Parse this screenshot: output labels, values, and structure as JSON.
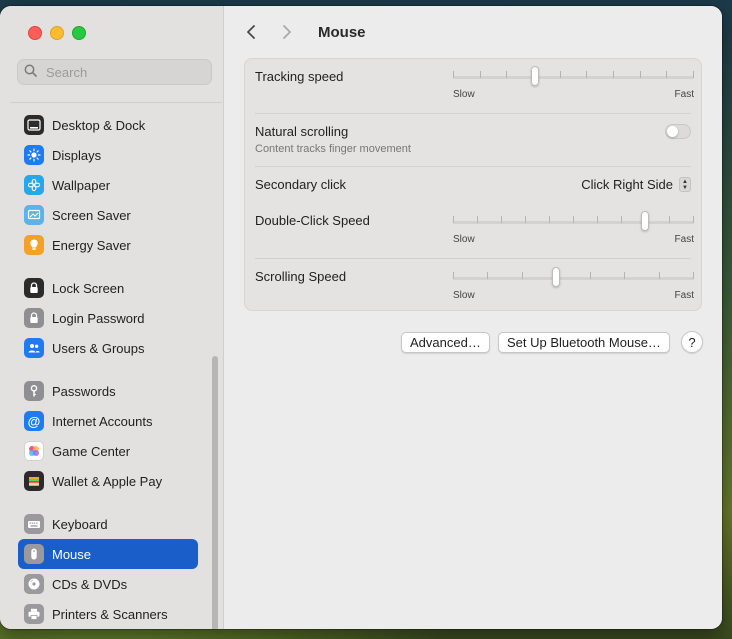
{
  "search": {
    "placeholder": "Search"
  },
  "sidebar": {
    "items": [
      {
        "label": "Desktop & Dock",
        "icon": "dock-icon",
        "color": "#2b2b2b"
      },
      {
        "label": "Displays",
        "icon": "sun-icon",
        "color": "#1e7bf0"
      },
      {
        "label": "Wallpaper",
        "icon": "flower-icon",
        "color": "#26a7e8"
      },
      {
        "label": "Screen Saver",
        "icon": "screensaver-icon",
        "color": "#5bb3e6"
      },
      {
        "label": "Energy Saver",
        "icon": "bulb-icon",
        "color": "#f6a028"
      },
      {
        "label": "Lock Screen",
        "icon": "lock-icon",
        "color": "#2b2b2b"
      },
      {
        "label": "Login Password",
        "icon": "lock-icon",
        "color": "#8e8e93"
      },
      {
        "label": "Users & Groups",
        "icon": "users-icon",
        "color": "#1e7bf0"
      },
      {
        "label": "Passwords",
        "icon": "key-icon",
        "color": "#8e8e93"
      },
      {
        "label": "Internet Accounts",
        "icon": "at-icon",
        "color": "#1e7bf0"
      },
      {
        "label": "Game Center",
        "icon": "gamecenter-icon",
        "color": "#ffffff"
      },
      {
        "label": "Wallet & Apple Pay",
        "icon": "wallet-icon",
        "color": "#2b2b2b"
      },
      {
        "label": "Keyboard",
        "icon": "keyboard-icon",
        "color": "#9a9a9e"
      },
      {
        "label": "Mouse",
        "icon": "mouse-icon",
        "color": "#9a9a9e"
      },
      {
        "label": "CDs & DVDs",
        "icon": "disc-icon",
        "color": "#9a9a9e"
      },
      {
        "label": "Printers & Scanners",
        "icon": "printer-icon",
        "color": "#9a9a9e"
      }
    ],
    "selected": "Mouse",
    "accent": "#1a5fc9"
  },
  "header": {
    "title": "Mouse"
  },
  "settings": {
    "tracking_speed": {
      "label": "Tracking speed",
      "min_label": "Slow",
      "max_label": "Fast",
      "ticks": 10,
      "value": 0.34
    },
    "natural_scrolling": {
      "label": "Natural scrolling",
      "description": "Content tracks finger movement",
      "enabled": false
    },
    "secondary_click": {
      "label": "Secondary click",
      "value": "Click Right Side"
    },
    "double_click_speed": {
      "label": "Double-Click Speed",
      "min_label": "Slow",
      "max_label": "Fast",
      "ticks": 11,
      "value": 0.8
    },
    "scrolling_speed": {
      "label": "Scrolling Speed",
      "min_label": "Slow",
      "max_label": "Fast",
      "ticks": 8,
      "value": 0.43
    }
  },
  "buttons": {
    "advanced": "Advanced…",
    "bluetooth": "Set Up Bluetooth Mouse…",
    "help": "?"
  }
}
